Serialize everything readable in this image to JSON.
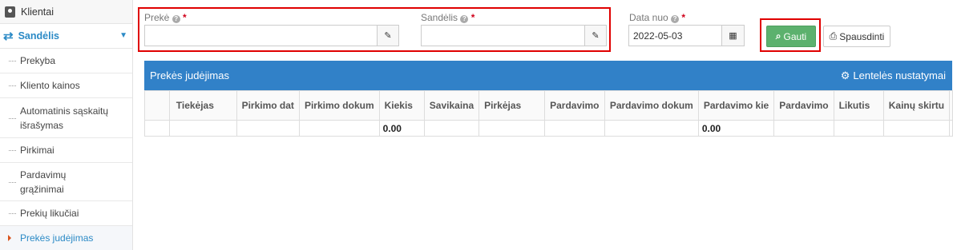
{
  "sidebar": {
    "top_item": "Klientai",
    "section": "Sandėlis",
    "items": [
      {
        "label": "Prekyba"
      },
      {
        "label": "Kliento kainos"
      },
      {
        "label": "Automatinis sąskaitų išrašymas"
      },
      {
        "label": "Pirkimai"
      },
      {
        "label": "Pardavimų grąžinimai"
      },
      {
        "label": "Prekių likučiai"
      },
      {
        "label": "Prekės judėjimas"
      }
    ]
  },
  "form": {
    "preke_label": "Prekė",
    "preke_value": "",
    "sandelis_label": "Sandėlis",
    "sandelis_value": "",
    "data_label": "Data nuo",
    "data_value": "2022-05-03",
    "required_mark": "*",
    "help_mark": "?"
  },
  "buttons": {
    "gauti": "Gauti",
    "spausdinti": "Spausdinti"
  },
  "panel": {
    "title": "Prekės judėjimas",
    "settings": "Lentelės nustatymai"
  },
  "table": {
    "columns": [
      "",
      "Tiekėjas",
      "Pirkimo dat",
      "Pirkimo dokum",
      "Kiekis",
      "Savikaina",
      "Pirkėjas",
      "Pardavimo",
      "Pardavimo dokum",
      "Pardavimo kie",
      "Pardavimo",
      "Likutis",
      "Kainų skirtu",
      ""
    ],
    "totals": [
      "",
      "",
      "",
      "",
      "0.00",
      "",
      "",
      "",
      "",
      "0.00",
      "",
      "",
      "",
      ""
    ]
  },
  "colors": {
    "accent": "#3181c8",
    "sidebar_accent": "#2b8ac6",
    "button_green": "#5cb16e",
    "highlight": "#e00000"
  }
}
